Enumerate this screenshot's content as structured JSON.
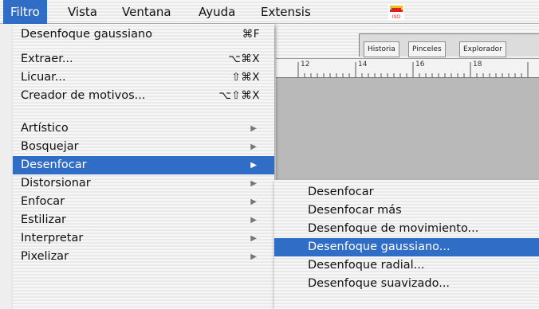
{
  "menubar": {
    "items": [
      {
        "label": "Filtro",
        "active": true
      },
      {
        "label": "Vista",
        "active": false
      },
      {
        "label": "Ventana",
        "active": false
      },
      {
        "label": "Ayuda",
        "active": false
      },
      {
        "label": "Extensis",
        "active": false
      }
    ],
    "iso_badge": "ISO"
  },
  "palette": {
    "tabs": [
      "Historia",
      "Pinceles",
      "Explorador"
    ]
  },
  "ruler": {
    "ticks": [
      "12",
      "14",
      "16",
      "18"
    ]
  },
  "filter_menu": {
    "items": [
      {
        "label": "Desenfoque gaussiano",
        "shortcut": "⌘F"
      },
      {
        "label": "Extraer...",
        "shortcut": "⌥⌘X"
      },
      {
        "label": "Licuar...",
        "shortcut": "⇧⌘X"
      },
      {
        "label": "Creador de motivos...",
        "shortcut": "⌥⇧⌘X"
      },
      {
        "label": "Artístico",
        "submenu": true
      },
      {
        "label": "Bosquejar",
        "submenu": true
      },
      {
        "label": "Desenfocar",
        "submenu": true,
        "highlighted": true
      },
      {
        "label": "Distorsionar",
        "submenu": true
      },
      {
        "label": "Enfocar",
        "submenu": true
      },
      {
        "label": "Estilizar",
        "submenu": true
      },
      {
        "label": "Interpretar",
        "submenu": true
      },
      {
        "label": "Pixelizar",
        "submenu": true
      }
    ]
  },
  "blur_submenu": {
    "items": [
      {
        "label": "Desenfocar"
      },
      {
        "label": "Desenfocar más"
      },
      {
        "label": "Desenfoque de movimiento..."
      },
      {
        "label": "Desenfoque gaussiano...",
        "highlighted": true
      },
      {
        "label": "Desenfoque radial..."
      },
      {
        "label": "Desenfoque suavizado..."
      }
    ]
  },
  "colors": {
    "highlight": "#2f6dc6",
    "highlight_text": "#ffffff"
  }
}
